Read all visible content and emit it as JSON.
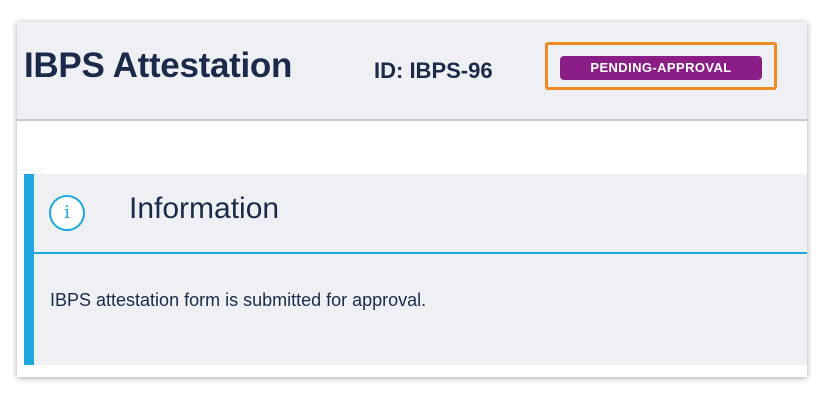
{
  "header": {
    "title": "IBPS Attestation",
    "record_id": "ID: IBPS-96",
    "status": "PENDING-APPROVAL"
  },
  "info_panel": {
    "icon": "info-icon",
    "icon_glyph": "i",
    "title": "Information",
    "message": "IBPS attestation form is submitted for approval."
  },
  "colors": {
    "status_badge": "#8a1e86",
    "highlight_border": "#f08a24",
    "info_accent": "#1ea7dc",
    "text": "#1b2a4a"
  }
}
